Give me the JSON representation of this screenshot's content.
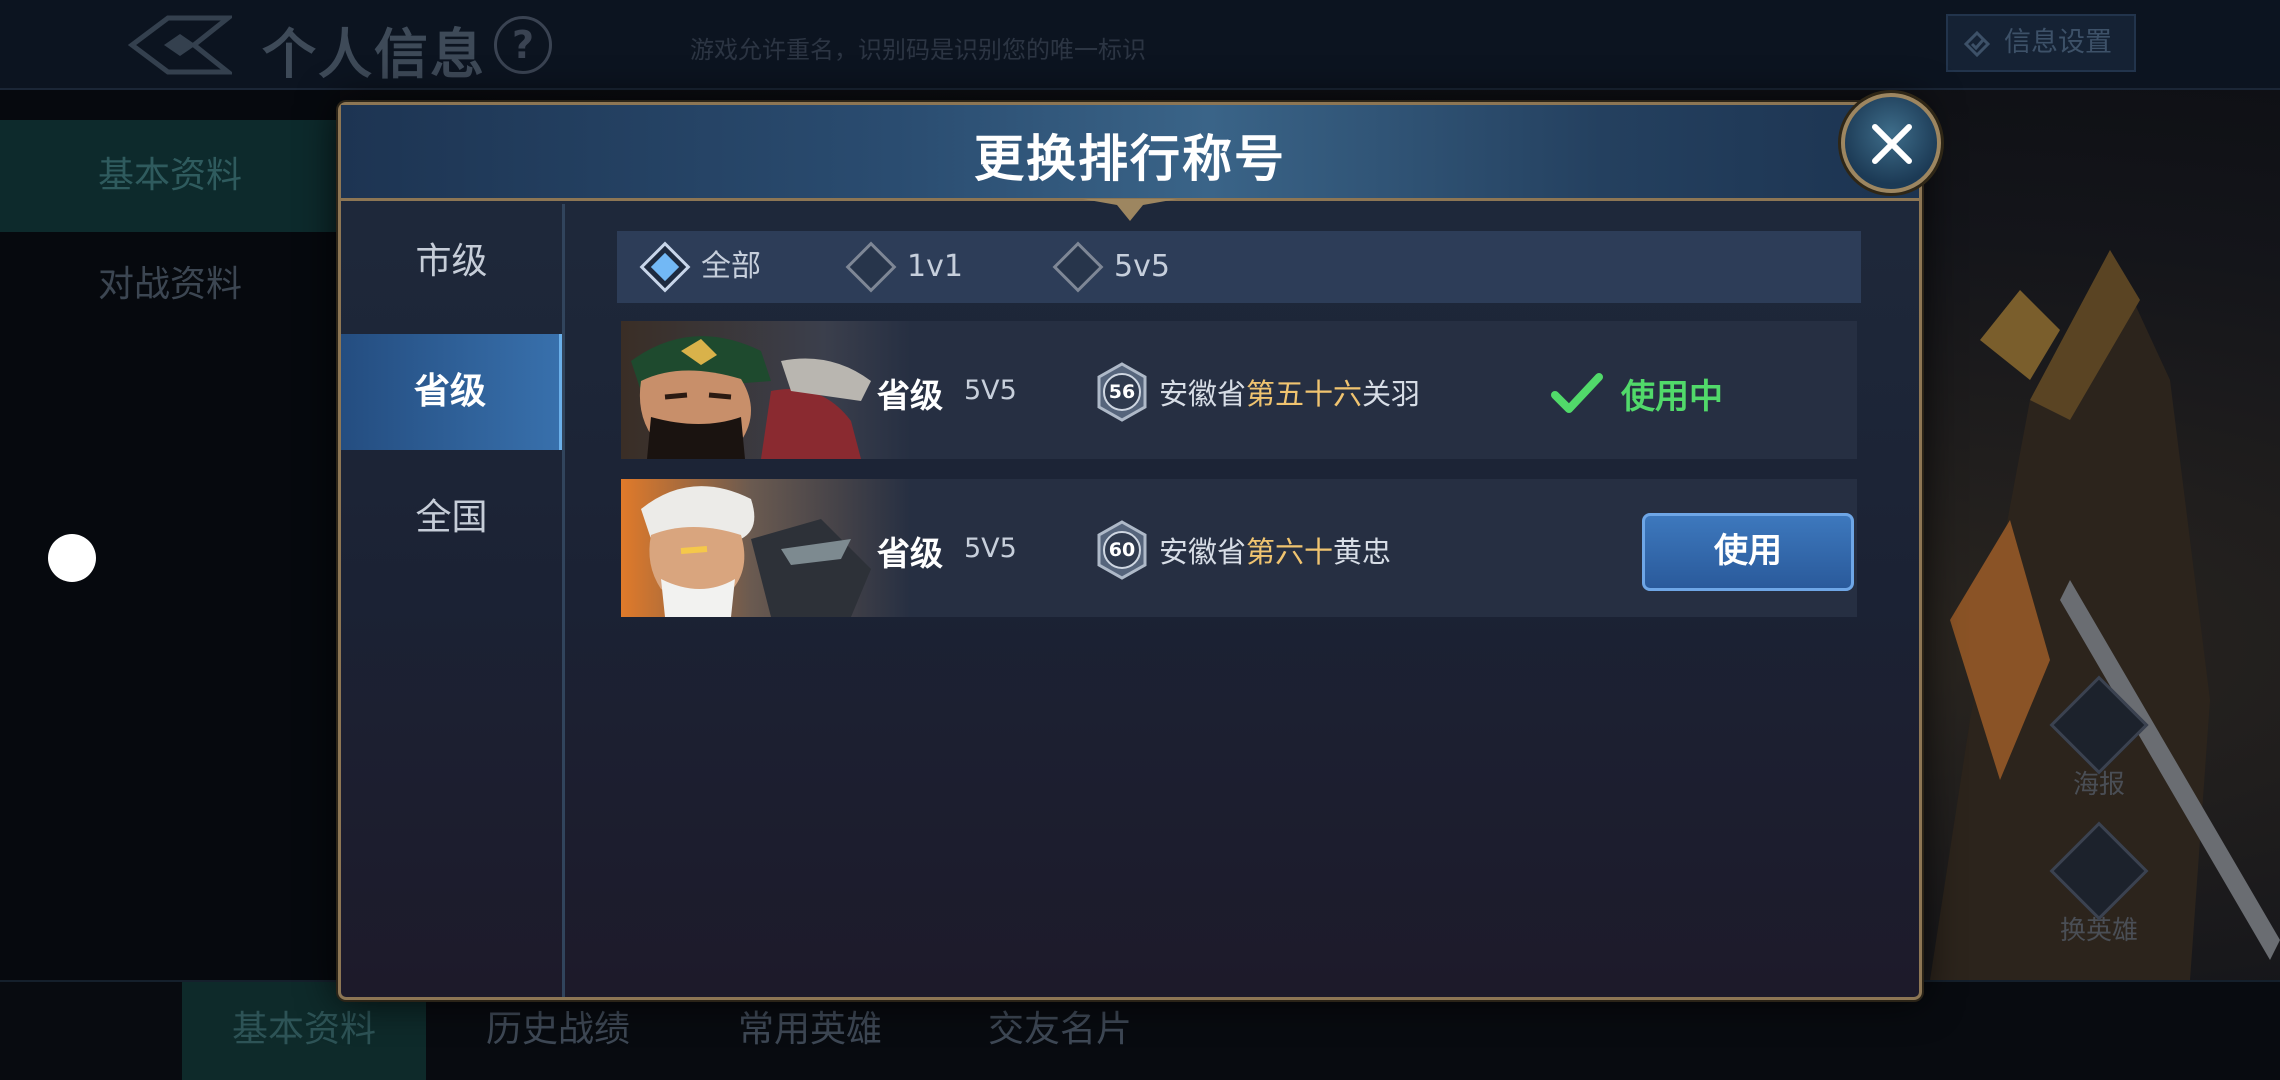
{
  "background": {
    "page_title": "个人信息",
    "help_symbol": "?",
    "hint": "游戏允许重名，识别码是识别您的唯一标识",
    "settings_button": "信息设置",
    "left_nav": [
      {
        "label": "基本资料",
        "active": true
      },
      {
        "label": "对战资料",
        "active": false
      }
    ],
    "bottom_tabs": [
      {
        "label": "基本资料",
        "active": true
      },
      {
        "label": "历史战绩",
        "active": false
      },
      {
        "label": "常用英雄",
        "active": false
      },
      {
        "label": "交友名片",
        "active": false
      }
    ],
    "side_buttons": [
      {
        "label": "海报",
        "icon": "poster-icon"
      },
      {
        "label": "换英雄",
        "icon": "switch-hero-icon"
      }
    ]
  },
  "dialog": {
    "title": "更换排行称号",
    "close_icon": "close-icon",
    "side_tabs": [
      {
        "label": "市级",
        "active": false
      },
      {
        "label": "省级",
        "active": true
      },
      {
        "label": "全国",
        "active": false
      }
    ],
    "filters": [
      {
        "label": "全部",
        "selected": true
      },
      {
        "label": "1v1",
        "selected": false
      },
      {
        "label": "5v5",
        "selected": false
      }
    ],
    "rows": [
      {
        "hero": "关羽",
        "level": "省级",
        "mode": "5V5",
        "rank_badge": "56",
        "title_prefix": "安徽省",
        "title_rank": "第五十六",
        "title_hero": "关羽",
        "status_label": "使用中",
        "in_use": true
      },
      {
        "hero": "黄忠",
        "level": "省级",
        "mode": "5V5",
        "rank_badge": "60",
        "title_prefix": "安徽省",
        "title_rank": "第六十",
        "title_hero": "黄忠",
        "button_label": "使用",
        "in_use": false
      }
    ]
  },
  "colors": {
    "highlight_gold": "#f0c470",
    "in_use_green": "#51d96a",
    "accent_blue": "#3870ac",
    "frame_gold": "#8d7654"
  }
}
